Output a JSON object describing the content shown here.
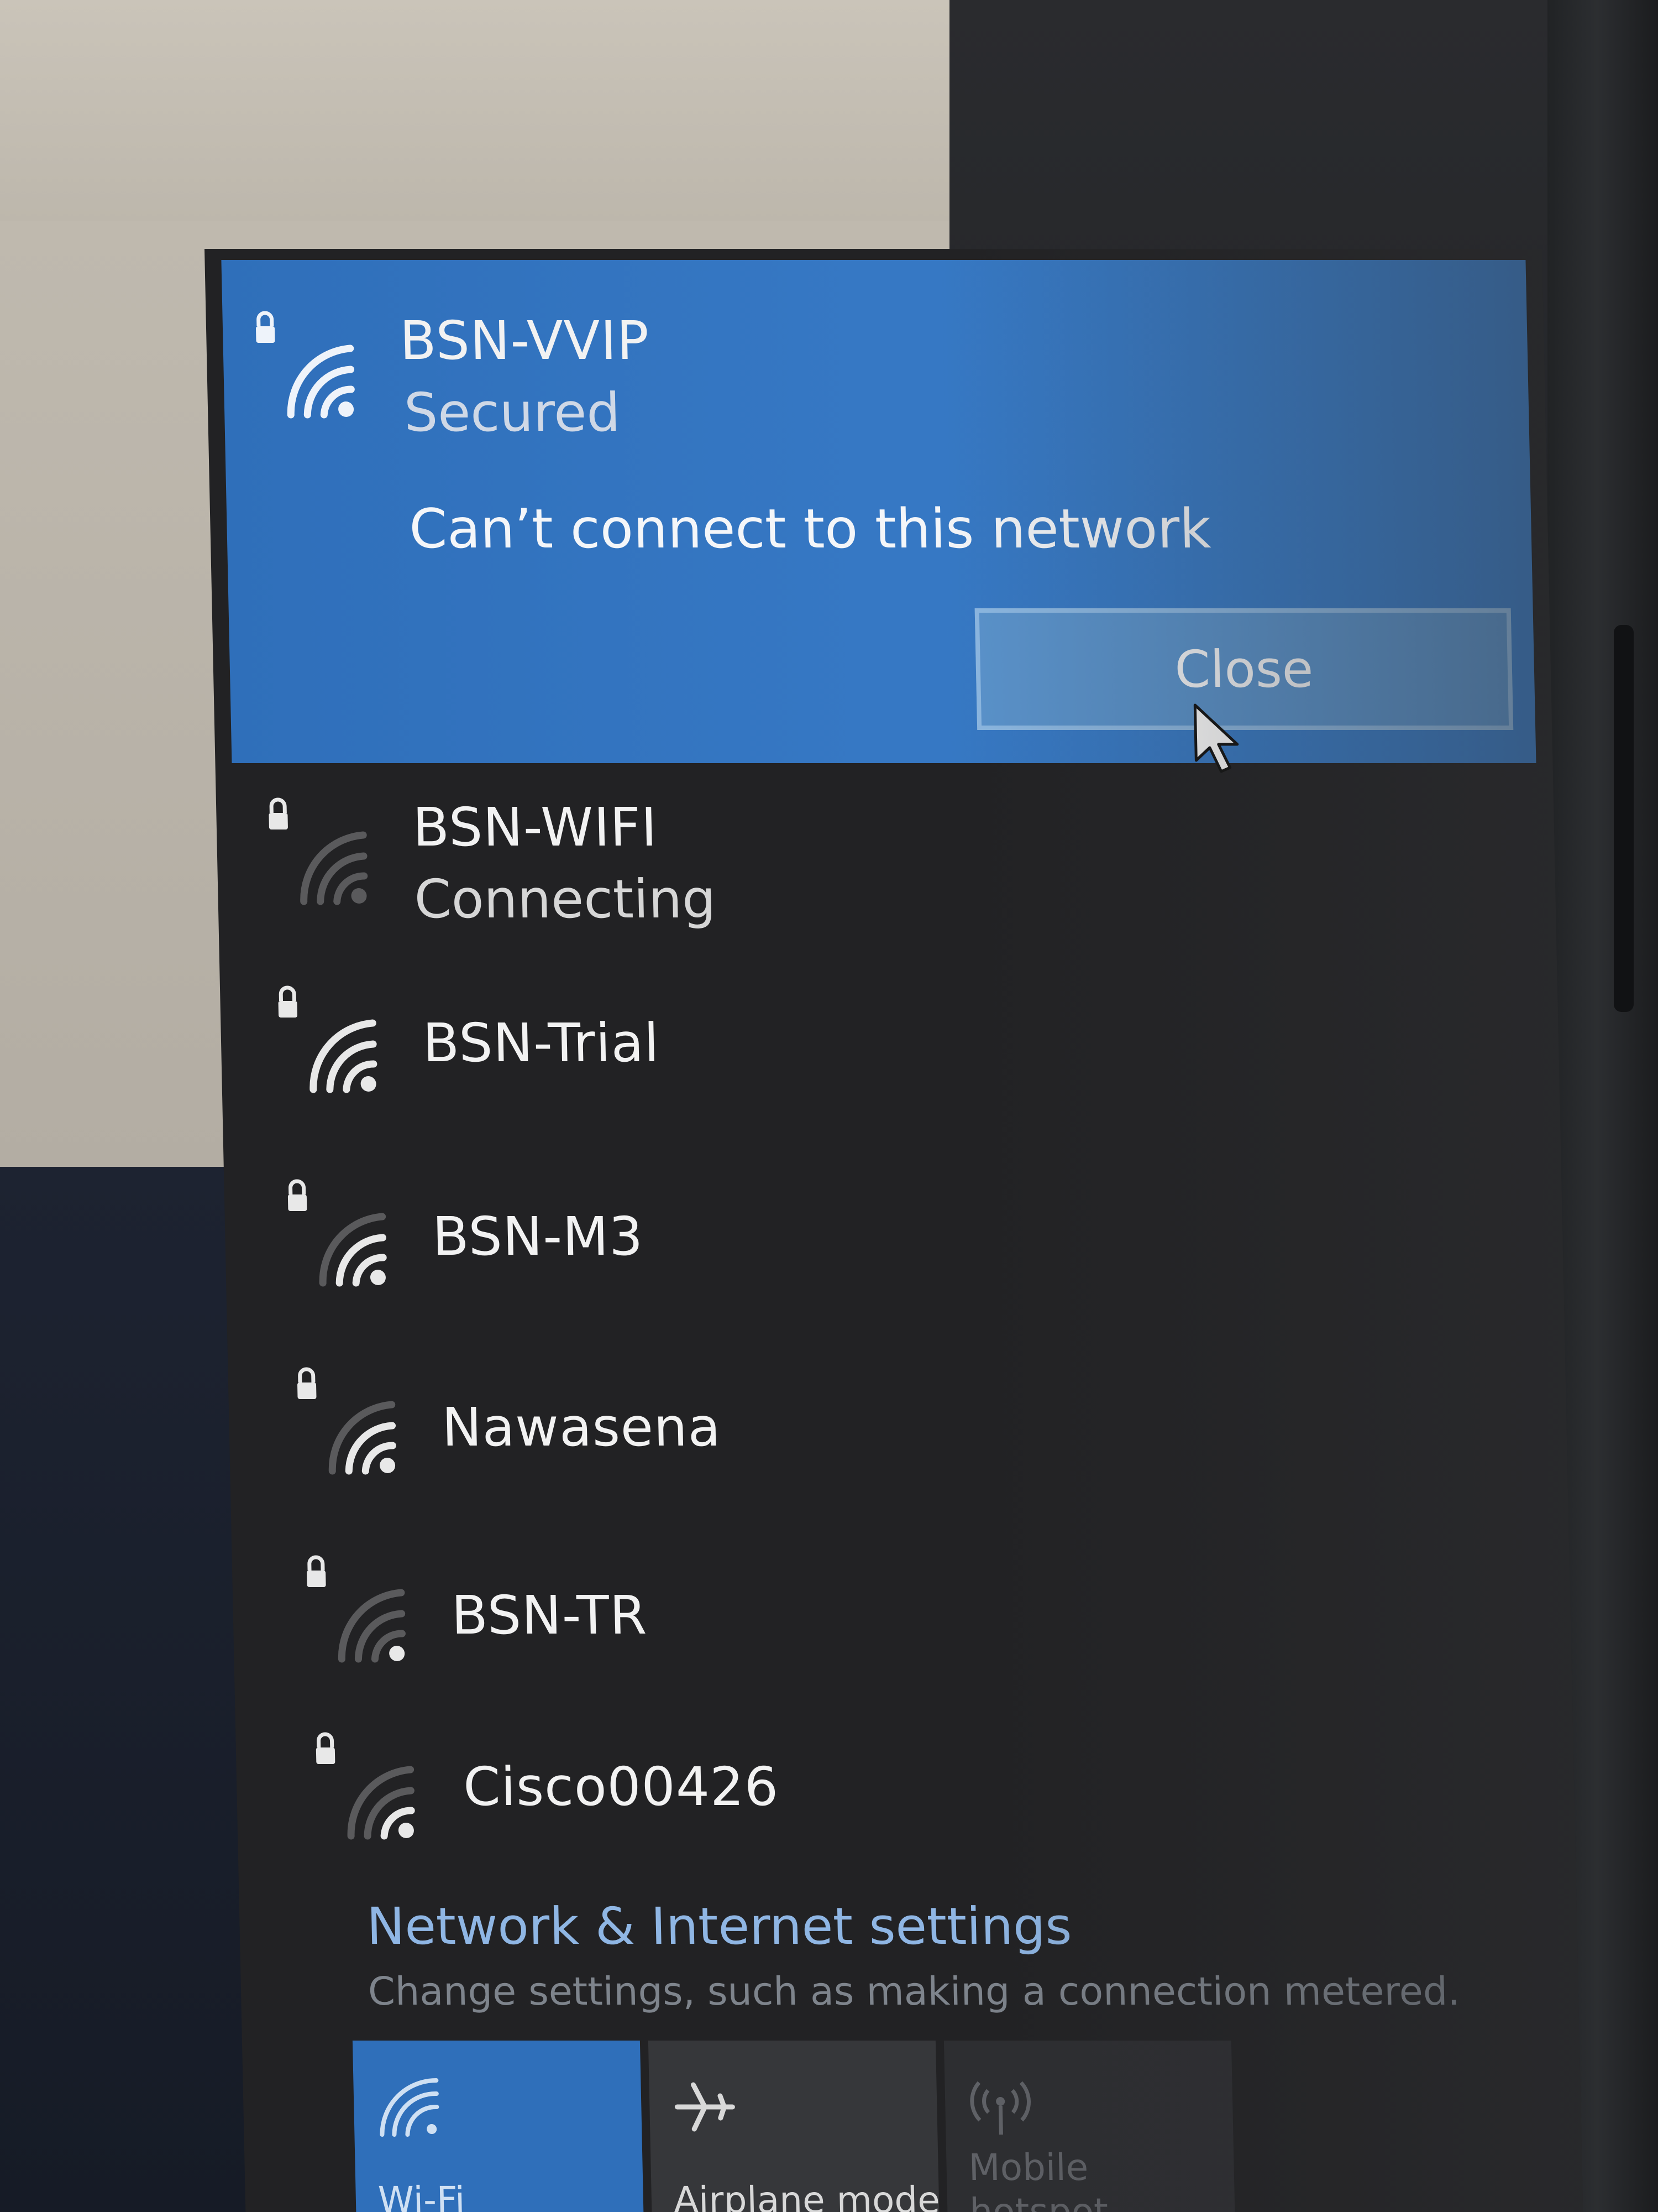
{
  "colors": {
    "accent": "#3678c4",
    "flyout_bg": "#222224",
    "link": "#8fb6e4"
  },
  "selected_network": {
    "name": "BSN-VVIP",
    "status": "Secured",
    "message": "Can’t connect to this network",
    "close_label": "Close",
    "icon": "wifi-secured-icon"
  },
  "networks": [
    {
      "name": "BSN-WIFI",
      "status": "Connecting",
      "icon": "wifi-secured-icon"
    },
    {
      "name": "BSN-Trial",
      "icon": "wifi-secured-icon"
    },
    {
      "name": "BSN-M3",
      "icon": "wifi-secured-icon"
    },
    {
      "name": "Nawasena",
      "icon": "wifi-secured-icon"
    },
    {
      "name": "BSN-TR",
      "icon": "wifi-secured-icon"
    },
    {
      "name": "Cisco00426",
      "icon": "wifi-secured-icon"
    }
  ],
  "settings": {
    "title": "Network & Internet settings",
    "subtitle": "Change settings, such as making a connection metered."
  },
  "quick_actions": [
    {
      "label": "Wi-Fi",
      "icon": "wifi-icon"
    },
    {
      "label": "Airplane mode",
      "icon": "airplane-icon"
    },
    {
      "label": "Mobile hotspot",
      "icon": "hotspot-icon"
    }
  ]
}
